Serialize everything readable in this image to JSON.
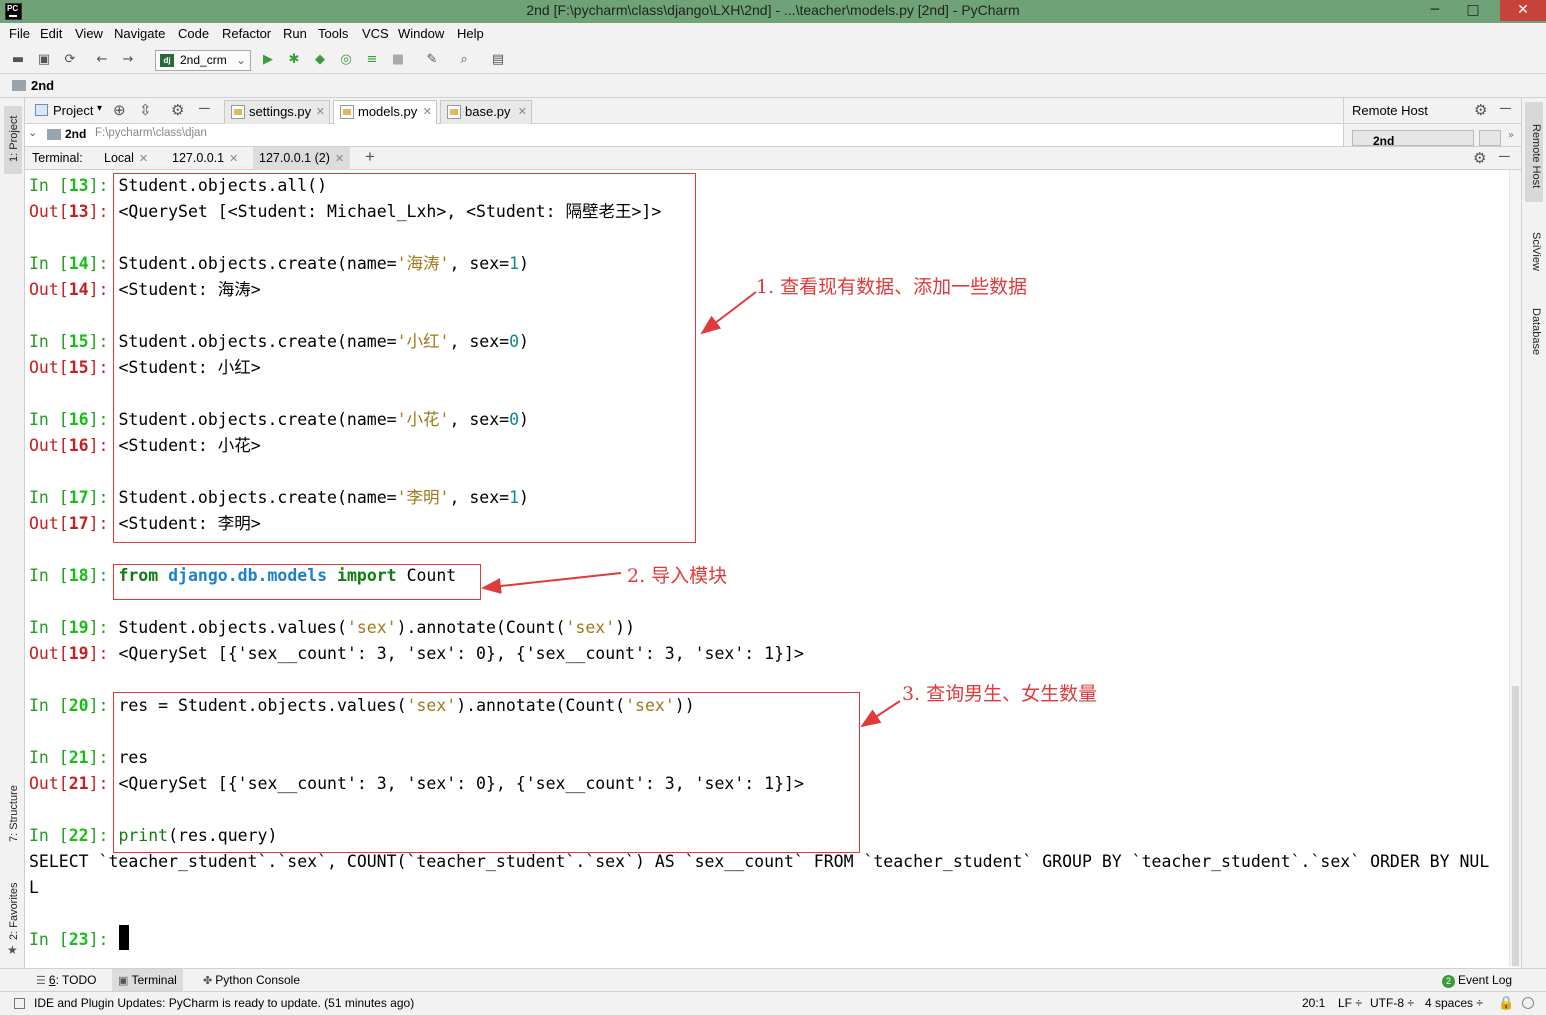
{
  "window": {
    "title": "2nd [F:\\pycharm\\class\\django\\LXH\\2nd] - ...\\teacher\\models.py [2nd] - PyCharm",
    "logo": "PC",
    "controls": {
      "minimize": "─",
      "maximize": "□",
      "close": "✕"
    }
  },
  "menu": [
    "File",
    "Edit",
    "View",
    "Navigate",
    "Code",
    "Refactor",
    "Run",
    "Tools",
    "VCS",
    "Window",
    "Help"
  ],
  "toolbar": {
    "run_config": "2nd_crm",
    "run_config_badge": "dj",
    "icons": [
      "open-icon",
      "save-icon",
      "sync-icon",
      "back-icon",
      "forward-icon",
      "run-icon",
      "debug-icon",
      "coverage-icon",
      "profile-icon",
      "concurrency-icon",
      "stop-icon",
      "settings-wrench-icon",
      "search-icon",
      "terminal-icon"
    ]
  },
  "nav": {
    "project": "2nd"
  },
  "project_panel": {
    "title": "Project",
    "root": "2nd",
    "root_path": "F:\\pycharm\\class\\djan"
  },
  "editor_tabs": [
    {
      "label": "settings.py",
      "active": false
    },
    {
      "label": "models.py",
      "active": true
    },
    {
      "label": "base.py",
      "active": false
    }
  ],
  "remote_host": {
    "title": "Remote Host",
    "selected": "2nd"
  },
  "left_strip": {
    "project": "1: Project",
    "structure": "7: Structure",
    "favorites": "2: Favorites"
  },
  "right_strip": {
    "remote": "Remote Host",
    "sciview": "SciView",
    "database": "Database"
  },
  "terminal": {
    "label": "Terminal:",
    "tabs": [
      {
        "label": "Local",
        "active": false
      },
      {
        "label": "127.0.0.1",
        "active": false
      },
      {
        "label": "127.0.0.1 (2)",
        "active": true
      }
    ],
    "new_tab": "+"
  },
  "console": {
    "prompt_in": "In [",
    "prompt_out": "Out[",
    "prompt_close": "]: ",
    "lines": [
      {
        "type": "in",
        "n": "13",
        "text": "Student.objects.all()"
      },
      {
        "type": "out",
        "n": "13",
        "text": "<QuerySet [<Student: Michael_Lxh>, <Student: 隔壁老王>]>"
      },
      {
        "type": "in",
        "n": "14",
        "pre": "Student.objects.create(name=",
        "str": "'海涛'",
        "mid": ", sex=",
        "num": "1",
        "post": ")"
      },
      {
        "type": "out",
        "n": "14",
        "text": "<Student: 海涛>"
      },
      {
        "type": "in",
        "n": "15",
        "pre": "Student.objects.create(name=",
        "str": "'小红'",
        "mid": ", sex=",
        "num": "0",
        "post": ")"
      },
      {
        "type": "out",
        "n": "15",
        "text": "<Student: 小红>"
      },
      {
        "type": "in",
        "n": "16",
        "pre": "Student.objects.create(name=",
        "str": "'小花'",
        "mid": ", sex=",
        "num": "0",
        "post": ")"
      },
      {
        "type": "out",
        "n": "16",
        "text": "<Student: 小花>"
      },
      {
        "type": "in",
        "n": "17",
        "pre": "Student.objects.create(name=",
        "str": "'李明'",
        "mid": ", sex=",
        "num": "1",
        "post": ")"
      },
      {
        "type": "out",
        "n": "17",
        "text": "<Student: 李明>"
      },
      {
        "type": "in",
        "n": "18",
        "kw1": "from",
        "mod": "django.db.models",
        "kw2": "import",
        "rest": "Count"
      },
      {
        "type": "in",
        "n": "19",
        "p1": "Student.objects.values(",
        "s1": "'sex'",
        "p2": ").annotate(Count(",
        "s2": "'sex'",
        "p3": "))"
      },
      {
        "type": "out",
        "n": "19",
        "text": "<QuerySet [{'sex__count': 3, 'sex': 0}, {'sex__count': 3, 'sex': 1}]>"
      },
      {
        "type": "in",
        "n": "20",
        "p1": "res = Student.objects.values(",
        "s1": "'sex'",
        "p2": ").annotate(Count(",
        "s2": "'sex'",
        "p3": "))"
      },
      {
        "type": "in",
        "n": "21",
        "text": "res"
      },
      {
        "type": "out",
        "n": "21",
        "text": "<QuerySet [{'sex__count': 3, 'sex': 0}, {'sex__count': 3, 'sex': 1}]>"
      },
      {
        "type": "in",
        "n": "22",
        "fn": "print",
        "rest": "(res.query)"
      },
      {
        "type": "plain",
        "text": "SELECT `teacher_student`.`sex`, COUNT(`teacher_student`.`sex`) AS `sex__count` FROM `teacher_student` GROUP BY `teacher_student`.`sex` ORDER BY NUL"
      },
      {
        "type": "plain",
        "text": "L"
      },
      {
        "type": "in",
        "n": "23",
        "text": ""
      }
    ]
  },
  "annotations": {
    "a1": "1. 查看现有数据、添加一些数据",
    "a2": "2. 导入模块",
    "a3": "3. 查询男生、女生数量"
  },
  "bottom_tabs": {
    "todo_num": "6",
    "todo": ": TODO",
    "terminal": "Terminal",
    "python_console": "Python Console",
    "event_log": "Event Log",
    "event_badge": "2"
  },
  "status": {
    "message": "IDE and Plugin Updates: PyCharm is ready to update. (51 minutes ago)",
    "position": "20:1",
    "line_sep": "LF ÷",
    "encoding": "UTF-8 ÷",
    "indent": "4 spaces ÷"
  },
  "colors": {
    "titlebar": "#6fa377",
    "annotation_red": "#e03a3a",
    "prompt_in": "#1f9e1f",
    "prompt_out": "#c81e1e",
    "string": "#a07a1a",
    "keyword": "#127a12",
    "module": "#1d7fd1"
  }
}
